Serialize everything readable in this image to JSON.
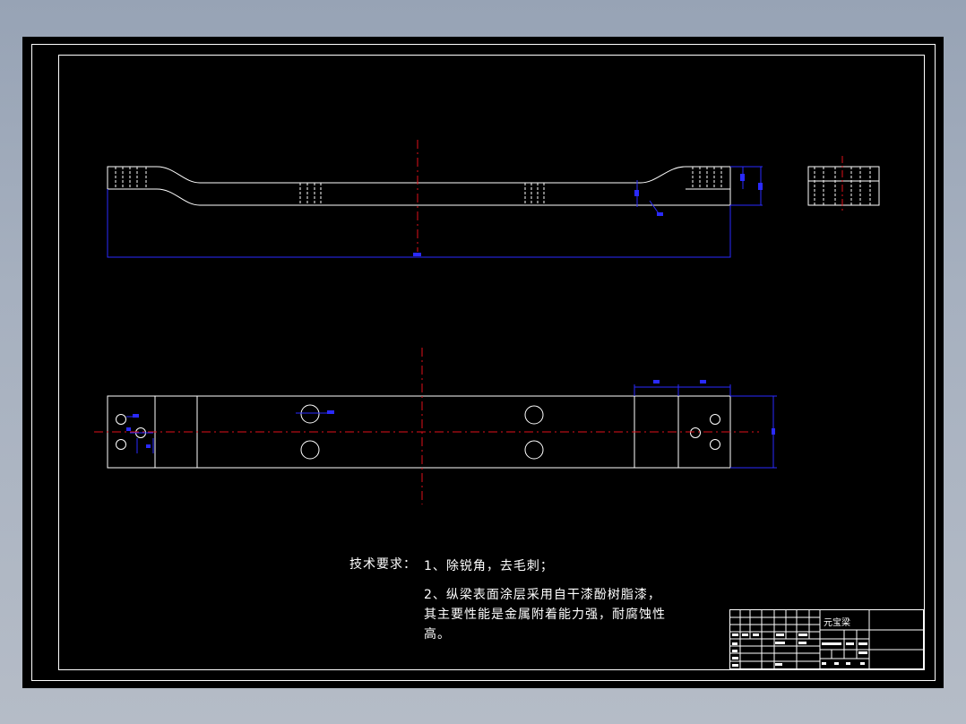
{
  "colors": {
    "background": "#97a3b5",
    "sheet": "#000000",
    "geometry": "#ffffff",
    "dimension": "#2a2aff",
    "centerline": "#e0101a"
  },
  "notes": {
    "heading": "技术要求：",
    "item1": "1、除锐角，去毛刺；",
    "item2_line1": "2、纵梁表面涂层采用自干漆酚树脂漆，",
    "item2_line2": "其主要性能是金属附着能力强，耐腐蚀性",
    "item2_line3": "高。"
  },
  "title_block": {
    "part_name": "元宝梁"
  }
}
